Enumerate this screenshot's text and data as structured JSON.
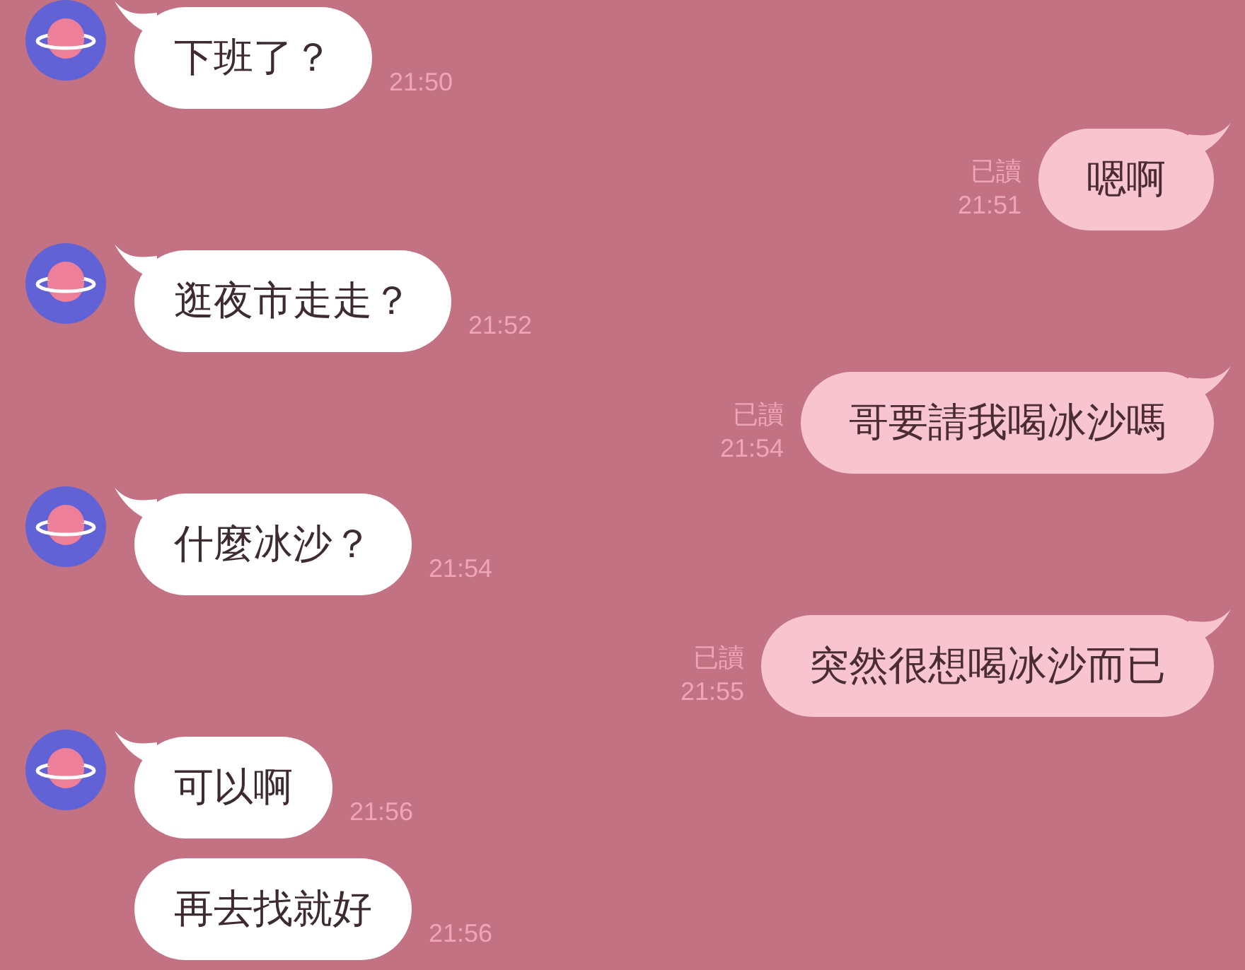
{
  "messages": [
    {
      "kind": "in",
      "avatar": true,
      "text": "下班了？",
      "time": "21:50"
    },
    {
      "kind": "out",
      "text": "嗯啊",
      "read_label": "已讀",
      "time": "21:51"
    },
    {
      "kind": "in",
      "avatar": true,
      "text": "逛夜市走走？",
      "time": "21:52"
    },
    {
      "kind": "out",
      "text": "哥要請我喝冰沙嗎",
      "read_label": "已讀",
      "time": "21:54"
    },
    {
      "kind": "in",
      "avatar": true,
      "text": "什麼冰沙？",
      "time": "21:54"
    },
    {
      "kind": "out",
      "text": "突然很想喝冰沙而已",
      "read_label": "已讀",
      "time": "21:55"
    },
    {
      "kind": "in",
      "avatar": true,
      "text": "可以啊",
      "time": "21:56"
    },
    {
      "kind": "in",
      "avatar": false,
      "text": "再去找就好",
      "time": "21:56"
    }
  ]
}
